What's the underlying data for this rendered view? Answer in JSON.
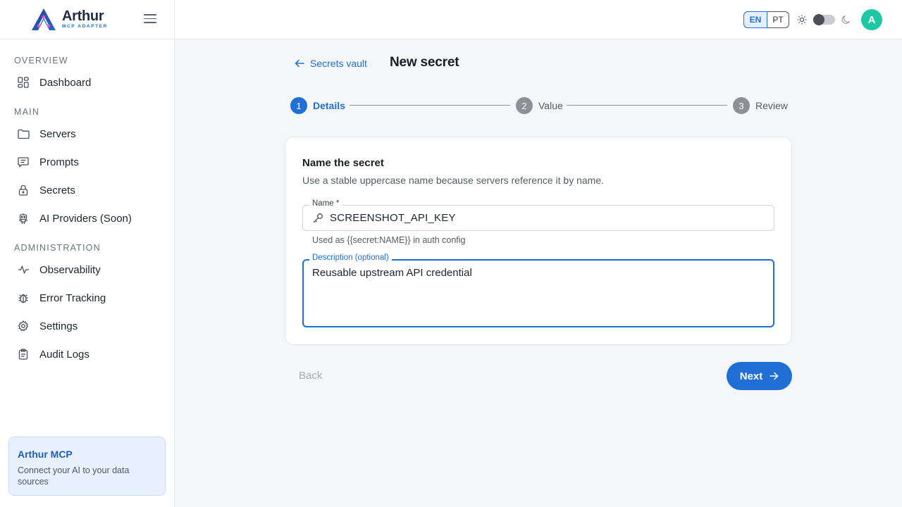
{
  "brand": {
    "name": "Arthur",
    "subtitle": "MCP ADAPTER",
    "accent": "#1f6fd6"
  },
  "sidebar": {
    "sections": [
      {
        "title": "OVERVIEW",
        "items": [
          {
            "label": "Dashboard",
            "icon": "dashboard-icon"
          }
        ]
      },
      {
        "title": "MAIN",
        "items": [
          {
            "label": "Servers",
            "icon": "folder-icon"
          },
          {
            "label": "Prompts",
            "icon": "message-icon"
          },
          {
            "label": "Secrets",
            "icon": "lock-icon"
          },
          {
            "label": "AI Providers (Soon)",
            "icon": "robot-icon"
          }
        ]
      },
      {
        "title": "ADMINISTRATION",
        "items": [
          {
            "label": "Observability",
            "icon": "activity-icon"
          },
          {
            "label": "Error Tracking",
            "icon": "bug-icon"
          },
          {
            "label": "Settings",
            "icon": "gear-icon"
          },
          {
            "label": "Audit Logs",
            "icon": "clipboard-icon"
          }
        ]
      }
    ],
    "card": {
      "title": "Arthur MCP",
      "text": "Connect your AI to your data sources"
    }
  },
  "topbar": {
    "languages": [
      "EN",
      "PT"
    ],
    "active_language": "EN",
    "avatar_initial": "A",
    "avatar_color": "#1ec8a5"
  },
  "page": {
    "back_label": "Secrets vault",
    "title": "New secret"
  },
  "stepper": {
    "steps": [
      {
        "number": "1",
        "label": "Details",
        "active": true
      },
      {
        "number": "2",
        "label": "Value",
        "active": false
      },
      {
        "number": "3",
        "label": "Review",
        "active": false
      }
    ]
  },
  "form": {
    "title": "Name the secret",
    "description": "Use a stable uppercase name because servers reference it by name.",
    "name_label": "Name *",
    "name_value": "SCREENSHOT_API_KEY",
    "name_helper": "Used as {{secret:NAME}} in auth config",
    "desc_label": "Description (optional)",
    "desc_value": "Reusable upstream API credential"
  },
  "actions": {
    "back": "Back",
    "next": "Next"
  }
}
